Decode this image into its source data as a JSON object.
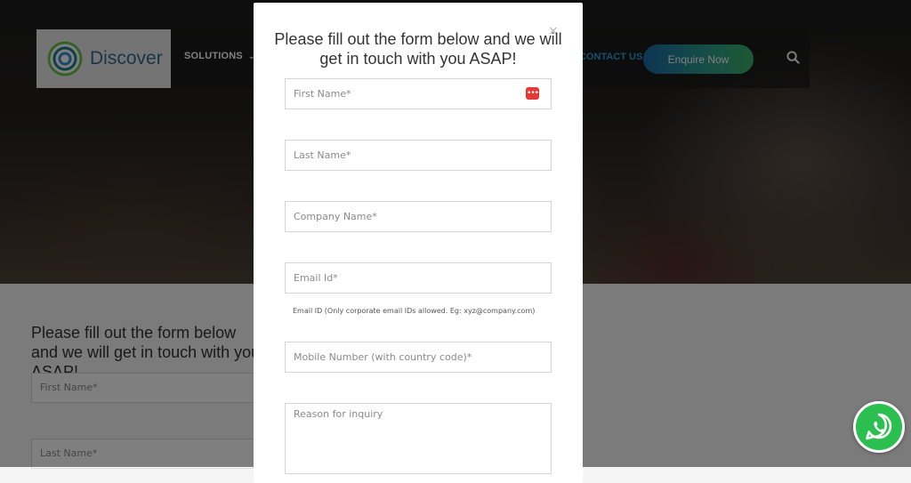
{
  "header": {
    "logo_text": "Discover",
    "nav_solutions": "SOLUTIONS",
    "nav_contact": "CONTACT US",
    "enquire_button": "Enquire Now"
  },
  "background_form": {
    "heading": "Please fill out the form below and we will get in touch with you ASAP!",
    "first_name": "First Name*",
    "last_name": "Last Name*"
  },
  "modal": {
    "close": "×",
    "title": "Please fill out the form below and we will get in touch with you ASAP!",
    "fields": {
      "first_name": "First Name*",
      "last_name": "Last Name*",
      "company_name": "Company Name*",
      "email": "Email Id*",
      "email_help": "Email ID (Only corporate email IDs allowed. Eg: xyz@company.com)",
      "mobile": "Mobile Number (with country code)*",
      "reason": "Reason for inquiry"
    }
  },
  "icons": {
    "search": "search-icon",
    "password_manager": "password-manager-icon",
    "whatsapp": "whatsapp-icon",
    "chevron": "chevron-down-icon"
  },
  "colors": {
    "accent_blue": "#2a9fd8",
    "enquire_gradient_start": "#1a6aa8",
    "enquire_gradient_end": "#3bb36a",
    "whatsapp_green": "#2bbf4f"
  }
}
